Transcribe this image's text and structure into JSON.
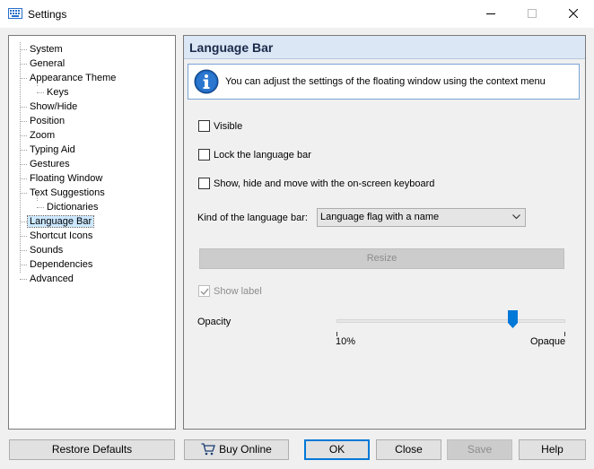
{
  "window": {
    "title": "Settings"
  },
  "tree": {
    "items": [
      {
        "label": "System"
      },
      {
        "label": "General"
      },
      {
        "label": "Appearance Theme"
      },
      {
        "label": "Keys"
      },
      {
        "label": "Show/Hide"
      },
      {
        "label": "Position"
      },
      {
        "label": "Zoom"
      },
      {
        "label": "Typing Aid"
      },
      {
        "label": "Gestures"
      },
      {
        "label": "Floating Window"
      },
      {
        "label": "Text Suggestions"
      },
      {
        "label": "Dictionaries"
      },
      {
        "label": "Language Bar"
      },
      {
        "label": "Shortcut Icons"
      },
      {
        "label": "Sounds"
      },
      {
        "label": "Dependencies"
      },
      {
        "label": "Advanced"
      }
    ],
    "selected": "Language Bar"
  },
  "panel": {
    "title": "Language Bar",
    "info": "You can adjust the settings of the floating window using the context menu",
    "visible_label": "Visible",
    "visible_checked": false,
    "lock_label": "Lock the language bar",
    "lock_checked": false,
    "showhide_label": "Show, hide and move with the on-screen keyboard",
    "showhide_checked": false,
    "kind_label": "Kind of the language bar:",
    "kind_value": "Language flag with a name",
    "resize_label": "Resize",
    "show_label_label": "Show label",
    "show_label_checked": true,
    "opacity_label": "Opacity",
    "opacity_min": "10%",
    "opacity_max": "Opaque",
    "opacity_value_fraction": 0.77
  },
  "buttons": {
    "restore": "Restore Defaults",
    "buy": "Buy Online",
    "ok": "OK",
    "close": "Close",
    "save": "Save",
    "help": "Help"
  },
  "colors": {
    "accent": "#0078d7",
    "selection": "#cce8ff",
    "header_bg": "#dbe7f5"
  },
  "icons": {
    "app": "keyboard-icon",
    "info": "info-icon",
    "buy": "shopping-cart-icon"
  }
}
